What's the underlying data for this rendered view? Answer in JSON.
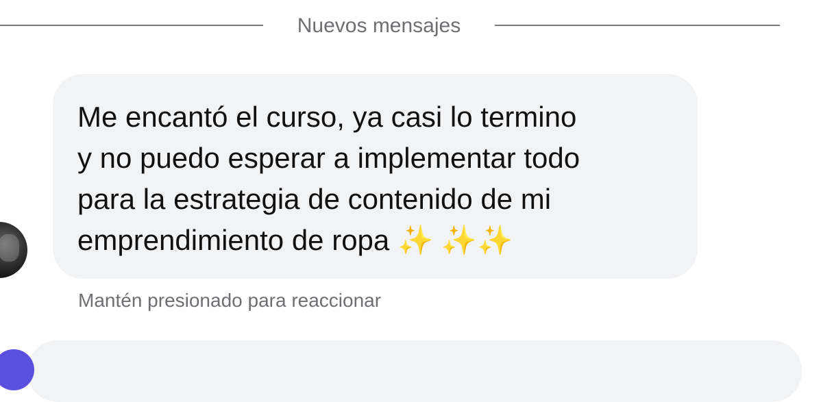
{
  "divider": {
    "label": "Nuevos mensajes"
  },
  "message": {
    "text": "Me encantó el curso, ya casi lo termino\ny no puedo esperar a implementar todo\npara la estrategia de contenido de mi\nemprendimiento de ropa ✨ ✨✨",
    "hint": "Mantén presionado para reaccionar"
  },
  "colors": {
    "bubble": "#f2f3f5",
    "text": "#111111",
    "muted": "#6f6f73",
    "divider": "#7a7a7a",
    "next_avatar": "#5b4fe0"
  }
}
